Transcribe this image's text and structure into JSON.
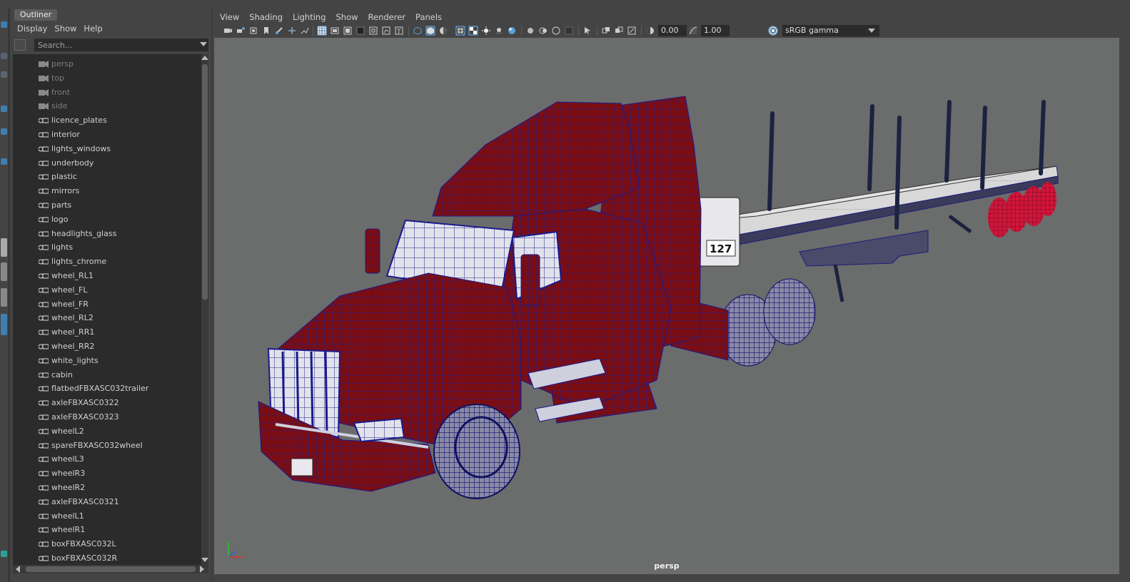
{
  "outliner": {
    "tab_label": "Outliner",
    "menu": [
      "Display",
      "Show",
      "Help"
    ],
    "search_placeholder": "Search...",
    "items": [
      {
        "label": "persp",
        "type": "camera",
        "dim": true
      },
      {
        "label": "top",
        "type": "camera",
        "dim": true
      },
      {
        "label": "front",
        "type": "camera",
        "dim": true
      },
      {
        "label": "side",
        "type": "camera",
        "dim": true
      },
      {
        "label": "licence_plates",
        "type": "group",
        "dim": false
      },
      {
        "label": "interior",
        "type": "group",
        "dim": false
      },
      {
        "label": "lights_windows",
        "type": "group",
        "dim": false
      },
      {
        "label": "underbody",
        "type": "group",
        "dim": false
      },
      {
        "label": "plastic",
        "type": "group",
        "dim": false
      },
      {
        "label": "mirrors",
        "type": "group",
        "dim": false
      },
      {
        "label": "parts",
        "type": "group",
        "dim": false
      },
      {
        "label": "logo",
        "type": "group",
        "dim": false
      },
      {
        "label": "headlights_glass",
        "type": "group",
        "dim": false
      },
      {
        "label": "lights",
        "type": "group",
        "dim": false
      },
      {
        "label": "lights_chrome",
        "type": "group",
        "dim": false
      },
      {
        "label": "wheel_RL1",
        "type": "group",
        "dim": false
      },
      {
        "label": "wheel_FL",
        "type": "group",
        "dim": false
      },
      {
        "label": "wheel_FR",
        "type": "group",
        "dim": false
      },
      {
        "label": "wheel_RL2",
        "type": "group",
        "dim": false
      },
      {
        "label": "wheel_RR1",
        "type": "group",
        "dim": false
      },
      {
        "label": "wheel_RR2",
        "type": "group",
        "dim": false
      },
      {
        "label": "white_lights",
        "type": "group",
        "dim": false
      },
      {
        "label": "cabin",
        "type": "group",
        "dim": false
      },
      {
        "label": "flatbedFBXASC032trailer",
        "type": "group",
        "dim": false
      },
      {
        "label": "axleFBXASC0322",
        "type": "group",
        "dim": false
      },
      {
        "label": "axleFBXASC0323",
        "type": "group",
        "dim": false
      },
      {
        "label": "wheelL2",
        "type": "group",
        "dim": false
      },
      {
        "label": "spareFBXASC032wheel",
        "type": "group",
        "dim": false
      },
      {
        "label": "wheelL3",
        "type": "group",
        "dim": false
      },
      {
        "label": "wheelR3",
        "type": "group",
        "dim": false
      },
      {
        "label": "wheelR2",
        "type": "group",
        "dim": false
      },
      {
        "label": "axleFBXASC0321",
        "type": "group",
        "dim": false
      },
      {
        "label": "wheelL1",
        "type": "group",
        "dim": false
      },
      {
        "label": "wheelR1",
        "type": "group",
        "dim": false
      },
      {
        "label": "boxFBXASC032L",
        "type": "group",
        "dim": false
      },
      {
        "label": "boxFBXASC032R",
        "type": "group",
        "dim": false
      }
    ]
  },
  "panel": {
    "menu": [
      "View",
      "Shading",
      "Lighting",
      "Show",
      "Renderer",
      "Panels"
    ],
    "exposure": "0.00",
    "gamma": "1.00",
    "color_space": "sRGB gamma",
    "camera": "persp",
    "trailer_sign": "127"
  },
  "colors": {
    "viewport_bg": "#6b6c6c",
    "mesh_red": "#7a0d14",
    "wire_blue": "#1a1a8c",
    "trailer_deck": "#dcdcdc",
    "accent": "#5a7fa3"
  }
}
